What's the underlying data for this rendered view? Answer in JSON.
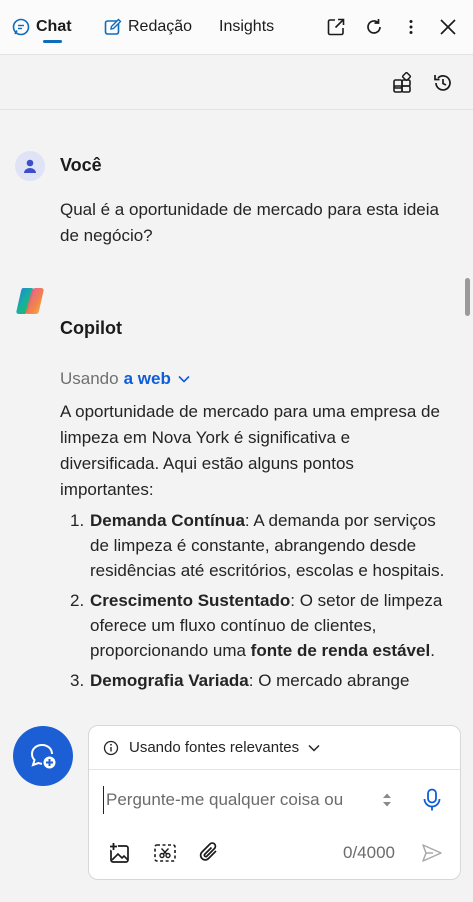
{
  "tabs": {
    "chat": "Chat",
    "redacao": "Redação",
    "insights": "Insights"
  },
  "user": {
    "name": "Você",
    "message": "Qual é a oportunidade de mercado para esta ideia de negócio?"
  },
  "copilot": {
    "name": "Copilot",
    "using_prefix": "Usando",
    "using_link": "a web",
    "intro": "A oportunidade de mercado para uma empresa de limpeza em Nova York é significativa e diversificada. Aqui estão alguns pontos importantes:",
    "points": [
      {
        "num": "1.",
        "title": "Demanda Contínua",
        "text": ": A demanda por serviços de limpeza é constante, abrangendo desde residências até escritórios, escolas e hospitais."
      },
      {
        "num": "2.",
        "title": "Crescimento Sustentado",
        "text_before": ": O setor de limpeza oferece um fluxo contínuo de clientes, proporcionando uma ",
        "highlight": "fonte de renda estável",
        "text_after": "."
      },
      {
        "num": "3.",
        "title": "Demografia Variada",
        "text": ": O mercado abrange"
      }
    ]
  },
  "composer": {
    "sources_label": "Usando fontes relevantes",
    "placeholder": "Pergunte-me qualquer coisa ou",
    "counter": "0/4000"
  },
  "colors": {
    "accent": "#0f6cbd",
    "fab": "#1c5fd4",
    "link": "#0f5ed7"
  }
}
